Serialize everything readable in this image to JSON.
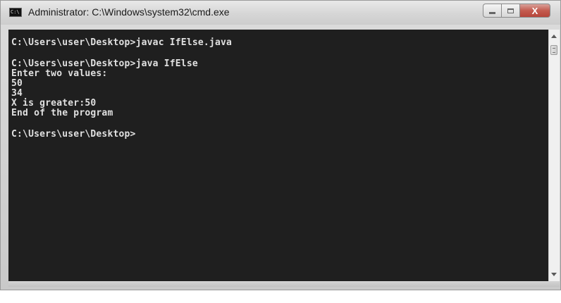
{
  "window": {
    "title": "Administrator: C:\\Windows\\system32\\cmd.exe",
    "app_icon_text": "C:\\",
    "close_label": "X"
  },
  "console": {
    "lines": [
      "C:\\Users\\user\\Desktop>javac IfElse.java",
      "",
      "C:\\Users\\user\\Desktop>java IfElse",
      "Enter two values:",
      "50",
      "34",
      "X is greater:50",
      "End of the program",
      "",
      "C:\\Users\\user\\Desktop>"
    ]
  },
  "colors": {
    "console_background": "#1f1f1f",
    "console_text": "#e0e0e0",
    "close_button": "#c45b4f"
  }
}
